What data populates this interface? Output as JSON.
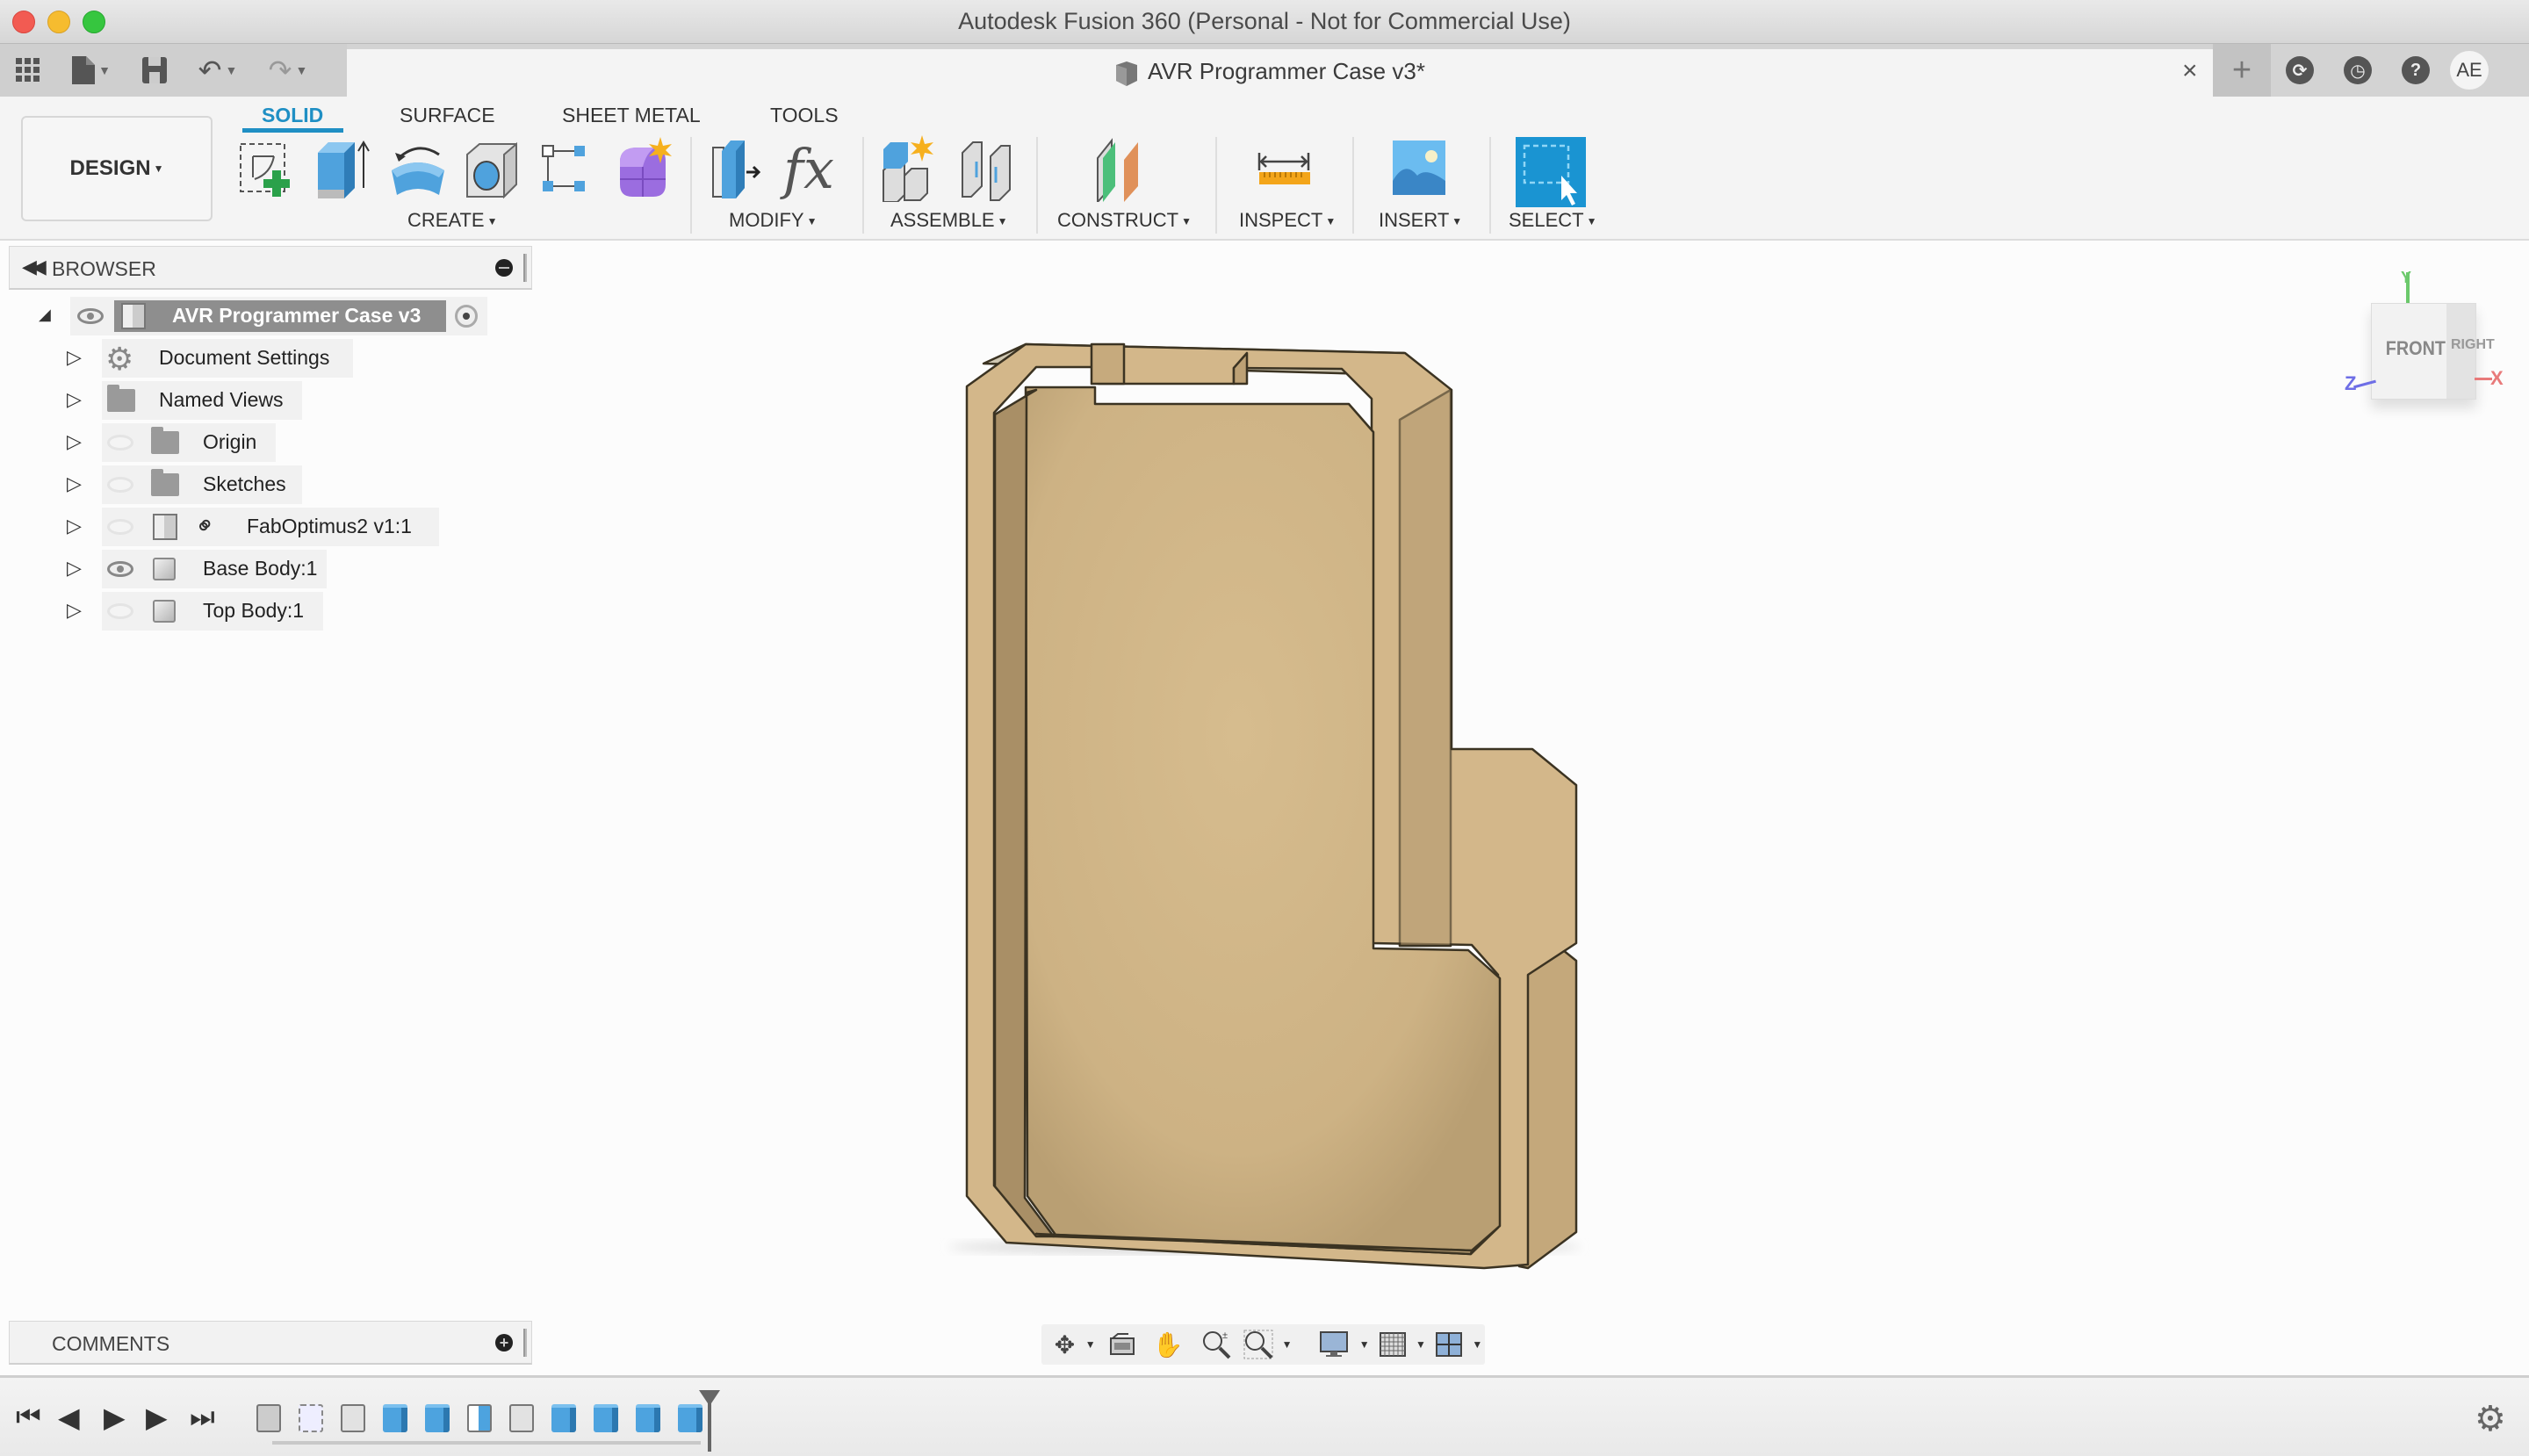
{
  "window": {
    "title": "Autodesk Fusion 360 (Personal - Not for Commercial Use)"
  },
  "quick_toolbar": {
    "icons": [
      "apps-grid-icon",
      "file-icon",
      "save-icon",
      "undo-icon",
      "redo-icon"
    ]
  },
  "document_tab": {
    "title": "AVR Programmer Case v3*",
    "close_label": "×"
  },
  "right_tools": {
    "new_tab": "+",
    "job_status": "job-status-icon",
    "notifications": "clock-icon",
    "help": "?",
    "user_initials": "AE"
  },
  "workspace": {
    "label": "DESIGN"
  },
  "toolbar_tabs": [
    {
      "label": "SOLID",
      "active": true
    },
    {
      "label": "SURFACE",
      "active": false
    },
    {
      "label": "SHEET METAL",
      "active": false
    },
    {
      "label": "TOOLS",
      "active": false
    }
  ],
  "toolbar_groups": {
    "create": "CREATE",
    "modify": "MODIFY",
    "assemble": "ASSEMBLE",
    "construct": "CONSTRUCT",
    "inspect": "INSPECT",
    "insert": "INSERT",
    "select": "SELECT"
  },
  "browser": {
    "title": "BROWSER",
    "root": "AVR Programmer Case v3",
    "items": [
      {
        "label": "Document Settings",
        "icon": "gear-icon",
        "visible": null
      },
      {
        "label": "Named Views",
        "icon": "folder-icon",
        "visible": null
      },
      {
        "label": "Origin",
        "icon": "folder-icon",
        "visible": false
      },
      {
        "label": "Sketches",
        "icon": "folder-icon",
        "visible": false
      },
      {
        "label": "FabOptimus2 v1:1",
        "icon": "component-link-icon",
        "visible": false
      },
      {
        "label": "Base Body:1",
        "icon": "body-icon",
        "visible": true
      },
      {
        "label": "Top Body:1",
        "icon": "body-icon",
        "visible": false
      }
    ]
  },
  "comments": {
    "title": "COMMENTS"
  },
  "viewcube": {
    "front": "FRONT",
    "right": "RIGHT",
    "axes": {
      "x": "X",
      "y": "Y",
      "z": "Z"
    },
    "colors": {
      "x": "#e87a7a",
      "y": "#6cc96c",
      "z": "#6e6ee6"
    }
  },
  "navbar": {
    "tools": [
      "orbit-icon",
      "look-at-icon",
      "pan-icon",
      "zoom-icon",
      "fit-icon",
      "display-settings-icon",
      "grid-icon",
      "viewports-icon"
    ]
  },
  "timeline": {
    "controls": [
      "first",
      "previous",
      "play",
      "next",
      "last"
    ],
    "features": [
      "link",
      "sketch",
      "body",
      "extrude",
      "extrude",
      "sketch-plane",
      "body",
      "extrude",
      "extrude",
      "extrude",
      "extrude"
    ]
  },
  "colors": {
    "accent": "#1f8fc4",
    "model_face": "#d4b98c",
    "model_edge": "#3b3322"
  }
}
